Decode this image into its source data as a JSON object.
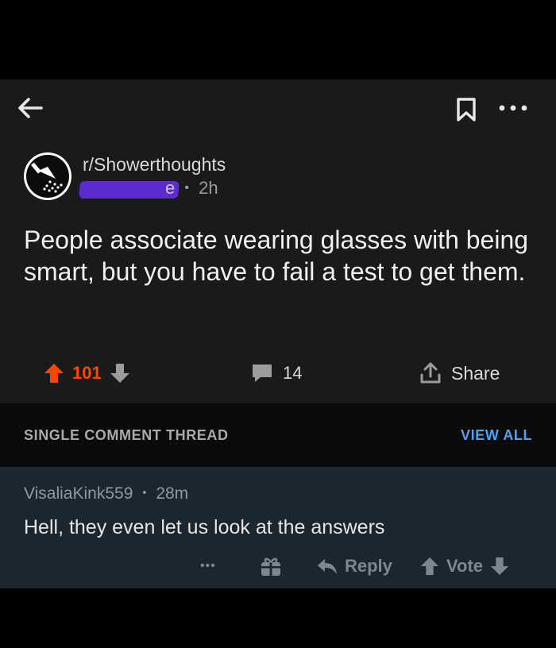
{
  "header": {
    "back_icon": "arrow-left-icon",
    "bookmark_icon": "bookmark-icon",
    "more_icon": "more-horizontal-icon"
  },
  "post": {
    "subreddit": "r/Showerthoughts",
    "author_visible_fragment": "e",
    "separator": "•",
    "age": "2h",
    "title": "People associate wearing glasses with being smart, but you have to fail a test to get them.",
    "upvotes": "101",
    "comments": "14",
    "share_label": "Share"
  },
  "thread": {
    "label": "SINGLE COMMENT THREAD",
    "view_all": "VIEW ALL"
  },
  "comment": {
    "author": "VisaliaKink559",
    "separator": "•",
    "age": "28m",
    "body": "Hell, they even let us look at the answers",
    "more_label": "•••",
    "reply_label": "Reply",
    "vote_label": "Vote"
  },
  "colors": {
    "upvote": "#ff4500",
    "link": "#4ea1f5",
    "post_bg": "#1a1a1b",
    "comment_bg": "#1b262f"
  }
}
